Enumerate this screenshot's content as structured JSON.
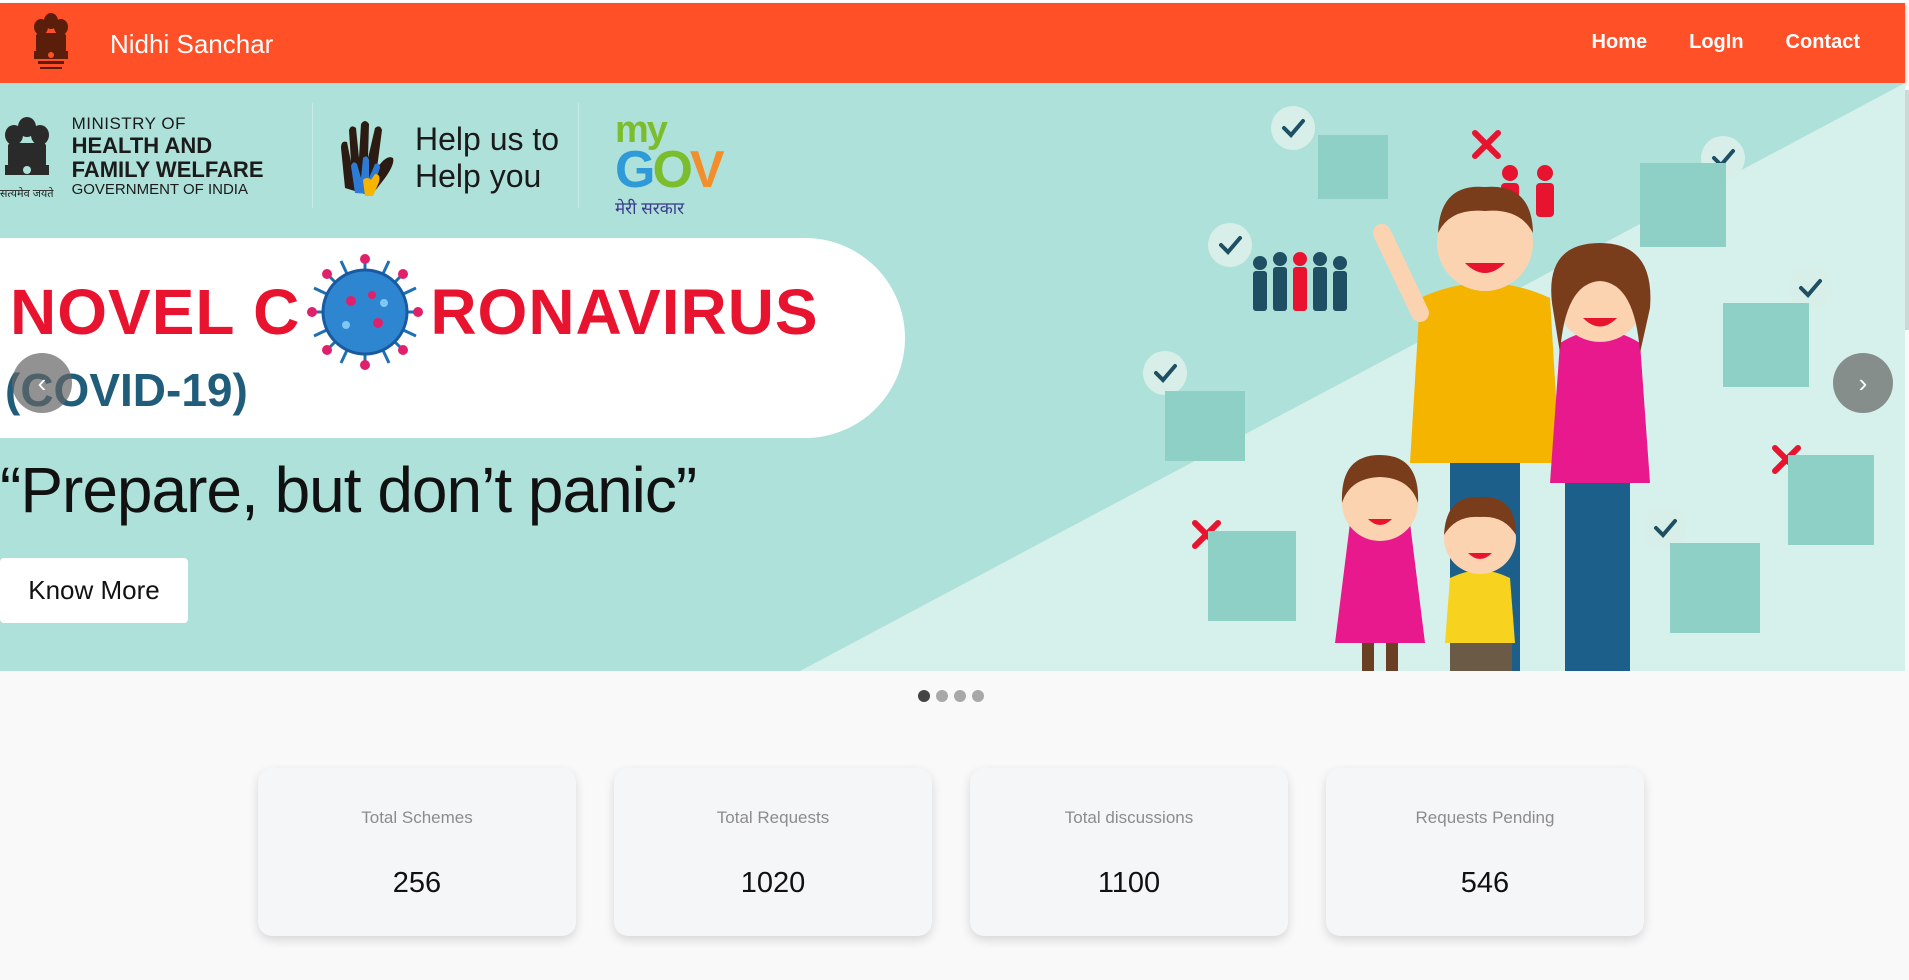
{
  "app": {
    "brand": "Nidhi Sanchar"
  },
  "nav": {
    "links": [
      {
        "label": "Home"
      },
      {
        "label": "LogIn"
      },
      {
        "label": "Contact"
      }
    ]
  },
  "icons": {
    "nav_emblem": "national-emblem-icon",
    "prev": "chevron-left-icon",
    "next": "chevron-right-icon"
  },
  "carousel": {
    "ministry": {
      "line1": "MINISTRY OF",
      "line2": "HEALTH AND",
      "line3": "FAMILY WELFARE",
      "line4": "GOVERNMENT OF INDIA",
      "emblem_caption": "सत्यमेव जयते"
    },
    "help": {
      "line1": "Help us to",
      "line2": "Help you"
    },
    "mygov": {
      "my": "my",
      "gov_g": "G",
      "gov_o": "O",
      "gov_v": "V",
      "hindi": "मेरी सरकार"
    },
    "title_left": "NOVEL C",
    "title_right": "RONAVIRUS",
    "subtitle": "(COVID-19)",
    "quote": "“Prepare, but don’t panic”",
    "button": "Know More",
    "prev_glyph": "‹",
    "next_glyph": "›",
    "slide_count": 4,
    "active_slide": 1
  },
  "stats": [
    {
      "label": "Total Schemes",
      "value": "256"
    },
    {
      "label": "Total Requests",
      "value": "1020"
    },
    {
      "label": "Total discussions",
      "value": "1100"
    },
    {
      "label": "Requests Pending",
      "value": "546"
    }
  ],
  "colors": {
    "navbar": "#ff5028",
    "banner": "#aee1da",
    "title_red": "#e8132e",
    "covid_blue": "#1f5d7b"
  }
}
